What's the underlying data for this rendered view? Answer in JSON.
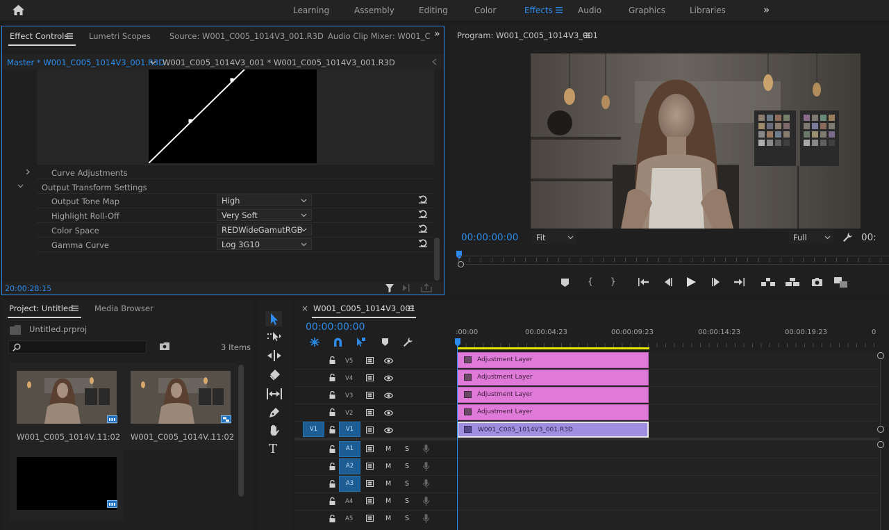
{
  "workspaces": {
    "home_icon": "home-icon",
    "items": [
      "Learning",
      "Assembly",
      "Editing",
      "Color",
      "Effects",
      "Audio",
      "Graphics",
      "Libraries"
    ],
    "active": "Effects",
    "more": "»"
  },
  "effect_controls": {
    "tabs": [
      "Effect Controls",
      "Lumetri Scopes",
      "Source: W001_C005_1014V3_001.R3D",
      "Audio Clip Mixer: W001_C"
    ],
    "more": "»",
    "master_label": "Master * W001_C005_1014V3_001.R3D",
    "clip_label": "W001_C005_1014V3_001 * W001_C005_1014V3_001.R3D",
    "curve_adjustments": "Curve Adjustments",
    "output_transform": "Output Transform Settings",
    "props": [
      {
        "label": "Output Tone Map",
        "value": "High"
      },
      {
        "label": "Highlight Roll-Off",
        "value": "Very Soft"
      },
      {
        "label": "Color Space",
        "value": "REDWideGamutRGB"
      },
      {
        "label": "Gamma Curve",
        "value": "Log 3G10"
      }
    ],
    "timecode": "20:00:28:15"
  },
  "program": {
    "title": "Program: W001_C005_1014V3_001",
    "timecode": "00:00:00:00",
    "fit": "Fit",
    "full": "Full",
    "timecode_right": "00:"
  },
  "project": {
    "tabs": [
      "Project: Untitled",
      "Media Browser"
    ],
    "file": "Untitled.prproj",
    "items_count": "3 Items",
    "clips": [
      {
        "name": "W001_C005_1014V...",
        "duration": "11:02"
      },
      {
        "name": "W001_C005_1014V...",
        "duration": "11:02"
      }
    ]
  },
  "timeline": {
    "title": "W001_C005_1014V3_001",
    "close": "×",
    "timecode": "00:00:00:00",
    "ruler": [
      ":00:00",
      "00:00:04:23",
      "00:00:09:23",
      "00:00:14:23",
      "00:00:19:23",
      "0"
    ],
    "video_tracks": [
      "V5",
      "V4",
      "V3",
      "V2",
      "V1"
    ],
    "source_patch": "V1",
    "audio_tracks": [
      "A1",
      "A2",
      "A3",
      "A4",
      "A5"
    ],
    "m_label": "M",
    "s_label": "S",
    "clips": [
      "Adjustment Layer",
      "Adjustment Layer",
      "Adjustment Layer",
      "Adjustment Layer",
      "W001_C005_1014V3_001.R3D"
    ]
  },
  "colors": {
    "accent": "#2d8ceb",
    "adjustment_clip": "#e07ad8",
    "video_clip": "#a08ee0"
  }
}
